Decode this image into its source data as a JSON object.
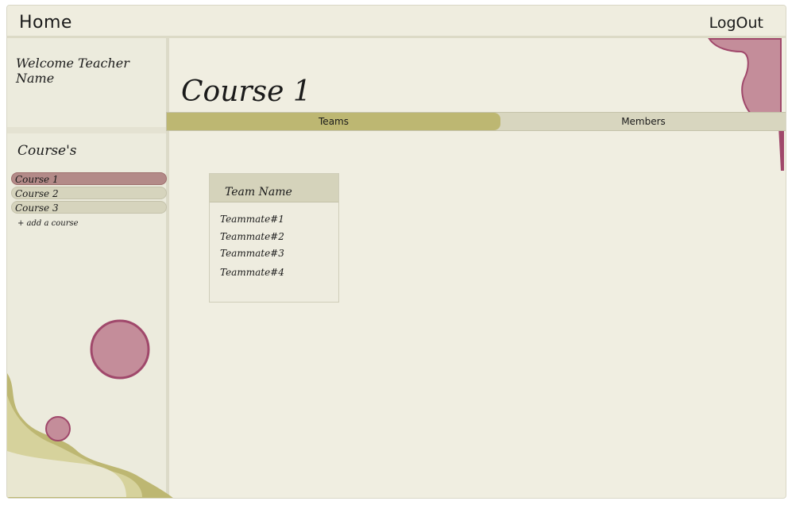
{
  "topbar": {
    "home_label": "Home",
    "logout_label": "LogOut"
  },
  "sidebar": {
    "welcome": "Welcome  Teacher  Name",
    "courses_heading": "Course's",
    "courses": [
      {
        "label": "Course 1",
        "active": true
      },
      {
        "label": "Course 2",
        "active": false
      },
      {
        "label": "Course 3",
        "active": false
      }
    ],
    "add_course_label": "+ add a course"
  },
  "main": {
    "course_title": "Course 1",
    "tabs": [
      {
        "label": "Teams",
        "active": true
      },
      {
        "label": "Members",
        "active": false
      }
    ],
    "team_card": {
      "team_name": "Team Name",
      "members": [
        "Teammate#1",
        "Teammate#2",
        "Teammate#3",
        "Teammate#4"
      ]
    }
  },
  "colors": {
    "background": "#f0eee1",
    "accent_olive": "#bdb772",
    "accent_rose": "#c48d9a",
    "accent_rose_border": "#a0486b"
  }
}
